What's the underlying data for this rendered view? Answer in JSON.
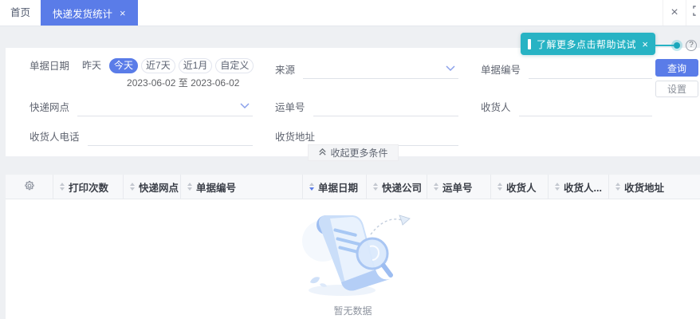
{
  "tabbar": {
    "home_label": "首页",
    "active_label": "快递发货统计",
    "close_glyph": "×",
    "close_all_glyph": "×"
  },
  "help_tip": {
    "text": "了解更多点击帮助试试",
    "close_glyph": "×"
  },
  "help_icon_glyph": "?",
  "filters": {
    "date": {
      "label": "单据日期",
      "options": [
        {
          "label": "昨天",
          "variant": "plain"
        },
        {
          "label": "今天",
          "variant": "selected"
        },
        {
          "label": "近7天",
          "variant": "outline"
        },
        {
          "label": "近1月",
          "variant": "outline"
        },
        {
          "label": "自定义",
          "variant": "outline"
        }
      ],
      "selected": "今天",
      "range": "2023-06-02 至 2023-06-02"
    },
    "source_label": "来源",
    "doc_no_label": "单据编号",
    "outlet_label": "快递网点",
    "tracking_label": "运单号",
    "consignee_label": "收货人",
    "phone_label": "收货人电话",
    "address_label": "收货地址",
    "collapse_label": "收起更多条件",
    "query_label": "查询",
    "settings_label": "设置"
  },
  "table": {
    "columns": [
      {
        "label": "打印次数"
      },
      {
        "label": "快递网点"
      },
      {
        "label": "单据编号"
      },
      {
        "label": "单据日期",
        "sort": "desc"
      },
      {
        "label": "快递公司"
      },
      {
        "label": "运单号"
      },
      {
        "label": "收货人"
      },
      {
        "label": "收货人...",
        "truncated": true
      },
      {
        "label": "收货地址"
      }
    ],
    "empty_text": "暂无数据"
  },
  "colors": {
    "accent": "#5a7ce8",
    "tooltip": "#27b3c4"
  }
}
